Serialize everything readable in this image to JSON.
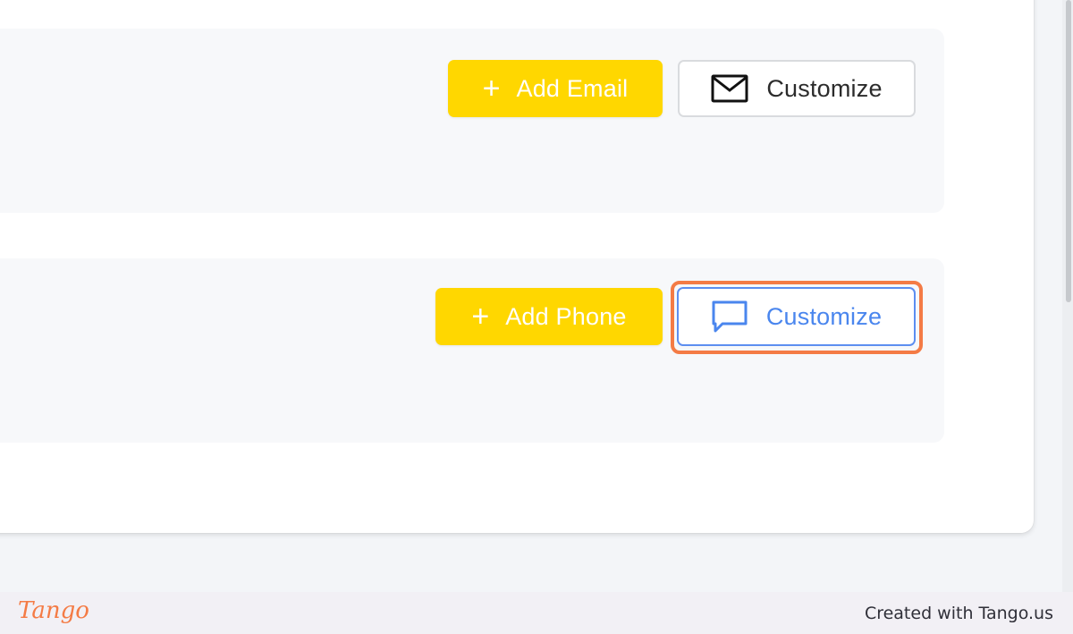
{
  "email_section": {
    "add_label": "Add Email",
    "add_icon": "plus-icon",
    "customize_label": "Customize",
    "customize_icon": "envelope-icon"
  },
  "phone_section": {
    "add_label": "Add Phone",
    "add_icon": "plus-icon",
    "customize_label": "Customize",
    "customize_icon": "chat-bubble-icon"
  },
  "footer": {
    "logo": "Tango",
    "credit": "Created with Tango.us"
  },
  "colors": {
    "accent_yellow": "#ffd700",
    "highlight_orange": "#f47b45",
    "link_blue": "#4a86ee"
  }
}
